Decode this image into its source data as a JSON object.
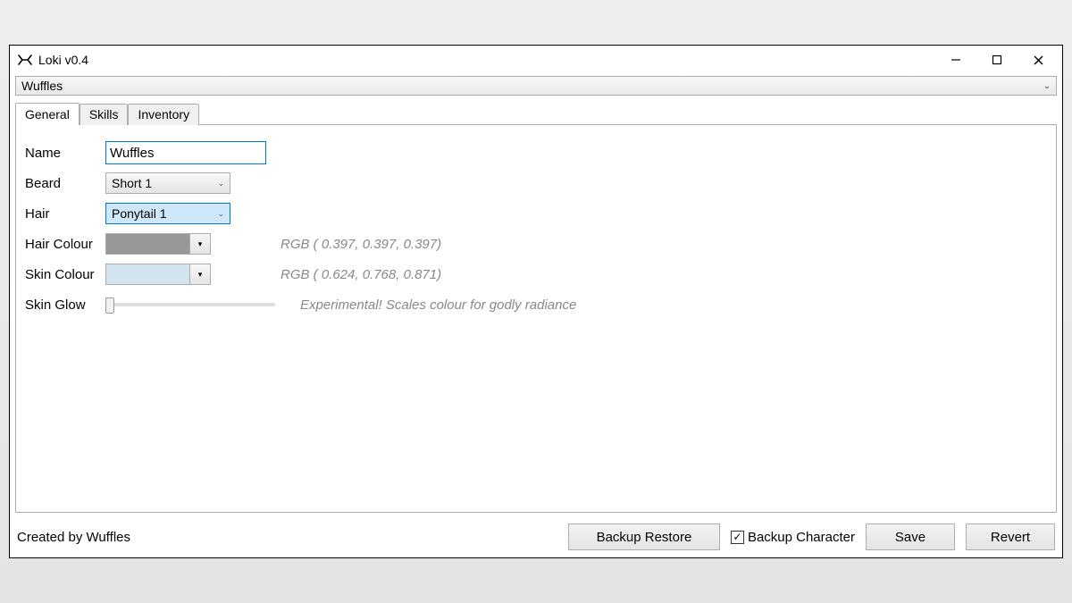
{
  "window": {
    "title": "Loki v0.4"
  },
  "character_select": {
    "value": "Wuffles"
  },
  "tabs": [
    {
      "label": "General",
      "active": true
    },
    {
      "label": "Skills",
      "active": false
    },
    {
      "label": "Inventory",
      "active": false
    }
  ],
  "general": {
    "name_label": "Name",
    "name_value": "Wuffles",
    "beard_label": "Beard",
    "beard_value": "Short 1",
    "hair_label": "Hair",
    "hair_value": "Ponytail 1",
    "hair_colour_label": "Hair Colour",
    "hair_colour_hex": "#989898",
    "hair_colour_hint": "RGB ( 0.397, 0.397, 0.397)",
    "skin_colour_label": "Skin Colour",
    "skin_colour_hex": "#d1e4f0",
    "skin_colour_hint": "RGB ( 0.624, 0.768, 0.871)",
    "skin_glow_label": "Skin Glow",
    "skin_glow_hint": "Experimental! Scales colour for godly radiance"
  },
  "footer": {
    "credit": "Created by Wuffles",
    "backup_restore": "Backup Restore",
    "backup_character_label": "Backup Character",
    "backup_character_checked": true,
    "save": "Save",
    "revert": "Revert"
  }
}
